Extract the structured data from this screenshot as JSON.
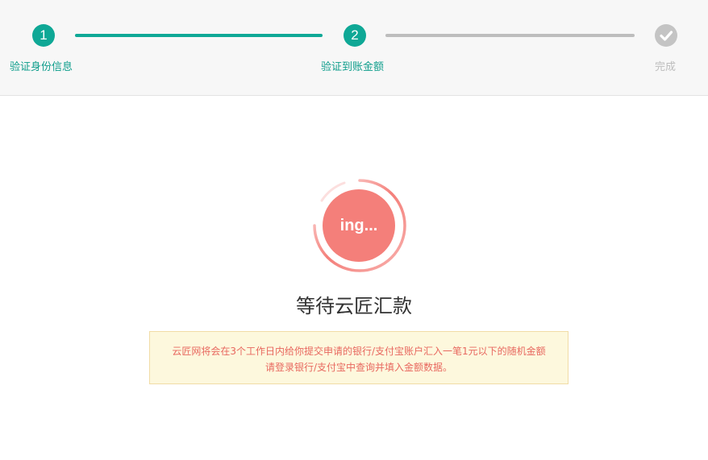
{
  "steps": [
    {
      "number": "1",
      "label": "验证身份信息",
      "state": "done"
    },
    {
      "number": "2",
      "label": "验证到账金额",
      "state": "active"
    },
    {
      "number": "",
      "label": "完成",
      "state": "pending",
      "icon": "check-icon"
    }
  ],
  "status": {
    "spinner_text": "ing...",
    "title": "等待云匠汇款"
  },
  "notice": {
    "line1": "云匠网将会在3个工作日内给你提交申请的银行/支付宝账户汇入一笔1元以下的随机金额",
    "line2": "请登录银行/支付宝中查询并填入金额数据。"
  },
  "colors": {
    "accent": "#0fa896",
    "pending": "#c4c4c4",
    "spinner": "#f47f7a",
    "notice_bg": "#fdf8dd",
    "notice_text": "#e8685f"
  }
}
